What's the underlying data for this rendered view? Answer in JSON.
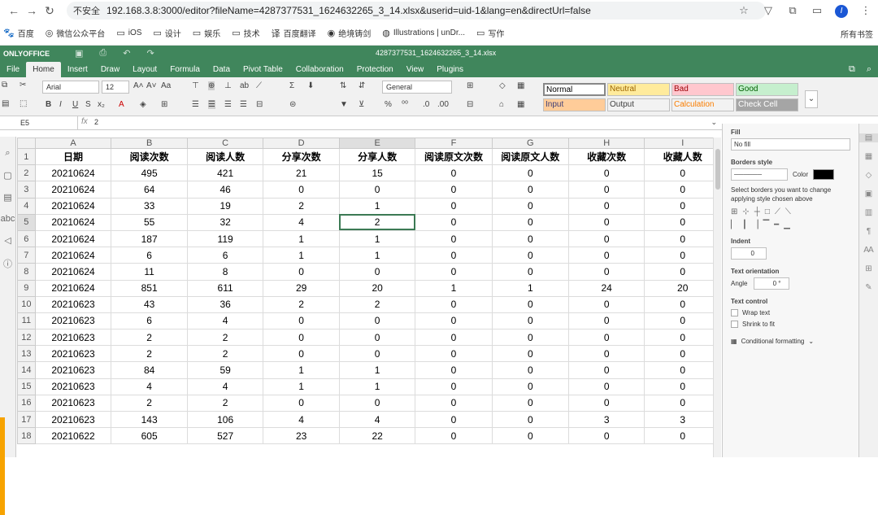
{
  "browser": {
    "security_label": "不安全",
    "url": "192.168.3.8:3000/editor?fileName=4287377531_1624632265_3_14.xlsx&userid=uid-1&lang=en&directUrl=false",
    "profile_initial": "I"
  },
  "bookmarks": [
    {
      "icon": "paw-icon",
      "label": "百度"
    },
    {
      "icon": "wechat-icon",
      "label": "微信公众平台"
    },
    {
      "icon": "folder-icon",
      "label": "iOS"
    },
    {
      "icon": "folder-icon",
      "label": "设计"
    },
    {
      "icon": "folder-icon",
      "label": "娱乐"
    },
    {
      "icon": "folder-icon",
      "label": "技术"
    },
    {
      "icon": "translate-icon",
      "label": "百度翻译"
    },
    {
      "icon": "globe-icon",
      "label": "绝境铸剑"
    },
    {
      "icon": "illustrations-icon",
      "label": "Illustrations | unDr..."
    },
    {
      "icon": "folder-icon",
      "label": "写作"
    }
  ],
  "bookmarks_right": "所有书签",
  "app": {
    "logo": "ONLYOFFICE",
    "filename": "4287377531_1624632265_3_14.xlsx"
  },
  "tabs": [
    "File",
    "Home",
    "Insert",
    "Draw",
    "Layout",
    "Formula",
    "Data",
    "Pivot Table",
    "Collaboration",
    "Protection",
    "View",
    "Plugins"
  ],
  "active_tab": "Home",
  "toolbar": {
    "font_name": "Arial",
    "font_size": "12",
    "number_format": "General",
    "styles": [
      {
        "label": "Normal",
        "bg": "#ffffff",
        "color": "#000000"
      },
      {
        "label": "Neutral",
        "bg": "#ffeb9c",
        "color": "#9c6500"
      },
      {
        "label": "Bad",
        "bg": "#ffc7ce",
        "color": "#9c0006"
      },
      {
        "label": "Good",
        "bg": "#c6efce",
        "color": "#006100"
      },
      {
        "label": "Input",
        "bg": "#ffcc99",
        "color": "#3f3f76"
      },
      {
        "label": "Output",
        "bg": "#f2f2f2",
        "color": "#3f3f3f"
      },
      {
        "label": "Calculation",
        "bg": "#f2f2f2",
        "color": "#fa7d00"
      },
      {
        "label": "Check Cell",
        "bg": "#a5a5a5",
        "color": "#ffffff"
      }
    ]
  },
  "formula_bar": {
    "cell_ref": "E5",
    "fx": "fx",
    "value": "2"
  },
  "sheet": {
    "columns": [
      "A",
      "B",
      "C",
      "D",
      "E",
      "F",
      "G",
      "H",
      "I"
    ],
    "selected_column": "E",
    "selected_row": 5,
    "rows": [
      {
        "n": 1,
        "cells": [
          "日期",
          "阅读次数",
          "阅读人数",
          "分享次数",
          "分享人数",
          "阅读原文次数",
          "阅读原文人数",
          "收藏次数",
          "收藏人数"
        ]
      },
      {
        "n": 2,
        "cells": [
          "20210624",
          "495",
          "421",
          "21",
          "15",
          "0",
          "0",
          "0",
          "0"
        ]
      },
      {
        "n": 3,
        "cells": [
          "20210624",
          "64",
          "46",
          "0",
          "0",
          "0",
          "0",
          "0",
          "0"
        ]
      },
      {
        "n": 4,
        "cells": [
          "20210624",
          "33",
          "19",
          "2",
          "1",
          "0",
          "0",
          "0",
          "0"
        ]
      },
      {
        "n": 5,
        "cells": [
          "20210624",
          "55",
          "32",
          "4",
          "2",
          "0",
          "0",
          "0",
          "0"
        ]
      },
      {
        "n": 6,
        "cells": [
          "20210624",
          "187",
          "119",
          "1",
          "1",
          "0",
          "0",
          "0",
          "0"
        ]
      },
      {
        "n": 7,
        "cells": [
          "20210624",
          "6",
          "6",
          "1",
          "1",
          "0",
          "0",
          "0",
          "0"
        ]
      },
      {
        "n": 8,
        "cells": [
          "20210624",
          "11",
          "8",
          "0",
          "0",
          "0",
          "0",
          "0",
          "0"
        ]
      },
      {
        "n": 9,
        "cells": [
          "20210624",
          "851",
          "611",
          "29",
          "20",
          "1",
          "1",
          "24",
          "20"
        ]
      },
      {
        "n": 10,
        "cells": [
          "20210623",
          "43",
          "36",
          "2",
          "2",
          "0",
          "0",
          "0",
          "0"
        ]
      },
      {
        "n": 11,
        "cells": [
          "20210623",
          "6",
          "4",
          "0",
          "0",
          "0",
          "0",
          "0",
          "0"
        ]
      },
      {
        "n": 12,
        "cells": [
          "20210623",
          "2",
          "2",
          "0",
          "0",
          "0",
          "0",
          "0",
          "0"
        ]
      },
      {
        "n": 13,
        "cells": [
          "20210623",
          "2",
          "2",
          "0",
          "0",
          "0",
          "0",
          "0",
          "0"
        ]
      },
      {
        "n": 14,
        "cells": [
          "20210623",
          "84",
          "59",
          "1",
          "1",
          "0",
          "0",
          "0",
          "0"
        ]
      },
      {
        "n": 15,
        "cells": [
          "20210623",
          "4",
          "4",
          "1",
          "1",
          "0",
          "0",
          "0",
          "0"
        ]
      },
      {
        "n": 16,
        "cells": [
          "20210623",
          "2",
          "2",
          "0",
          "0",
          "0",
          "0",
          "0",
          "0"
        ]
      },
      {
        "n": 17,
        "cells": [
          "20210623",
          "143",
          "106",
          "4",
          "4",
          "0",
          "0",
          "3",
          "3"
        ]
      },
      {
        "n": 18,
        "cells": [
          "20210622",
          "605",
          "527",
          "23",
          "22",
          "0",
          "0",
          "0",
          "0"
        ]
      }
    ]
  },
  "right_panel": {
    "fill_label": "Fill",
    "fill_value": "No fill",
    "borders_label": "Borders style",
    "color_label": "Color",
    "border_color": "#000000",
    "borders_hint": "Select borders you want to change applying style chosen above",
    "indent_label": "Indent",
    "indent_value": "0",
    "orientation_label": "Text orientation",
    "angle_label": "Angle",
    "angle_value": "0 °",
    "text_control_label": "Text control",
    "wrap_label": "Wrap text",
    "shrink_label": "Shrink to fit",
    "conditional_label": "Conditional formatting"
  }
}
